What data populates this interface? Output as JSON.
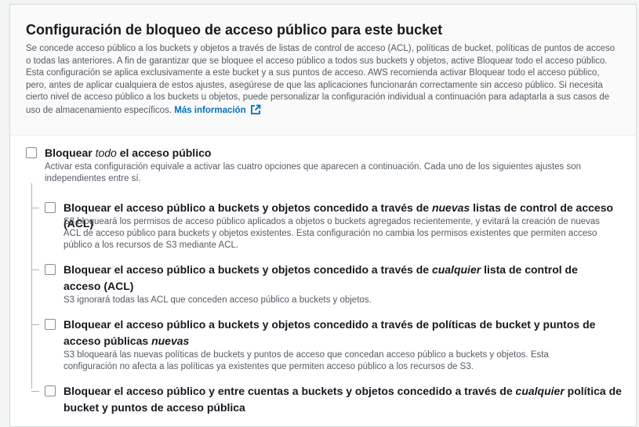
{
  "header": {
    "title": "Configuración de bloqueo de acceso público para este bucket",
    "description": "Se concede acceso público a los buckets y objetos a través de listas de control de acceso (ACL), políticas de bucket, políticas de puntos de acceso o todas las anteriores. A fin de garantizar que se bloquee el acceso público a todos sus buckets y objetos, active Bloquear todo el acceso público. Esta configuración se aplica exclusivamente a este bucket y a sus puntos de acceso. AWS recomienda activar Bloquear todo el acceso público, pero, antes de aplicar cualquiera de estos ajustes, asegúrese de que las aplicaciones funcionarán correctamente sin acceso público. Si necesita cierto nivel de acceso público a los buckets u objetos, puede personalizar la configuración individual a continuación para adaptarla a sus casos de uso de almacenamiento específicos.",
    "learn_more": "Más información",
    "learn_more_icon": "external-link-icon"
  },
  "block_all": {
    "label_pre": "Bloquear ",
    "label_em": "todo",
    "label_post": " el acceso público",
    "description": "Activar esta configuración equivale a activar las cuatro opciones que aparecen a continuación. Cada uno de los siguientes ajustes son independientes entre sí.",
    "checked": false
  },
  "options": [
    {
      "label_pre": "Bloquear el acceso público a buckets y objetos concedido a través de ",
      "label_em": "nuevas",
      "label_post": " listas de control de acceso (ACL)",
      "description": "S3 bloqueará los permisos de acceso público aplicados a objetos o buckets agregados recientemente, y evitará la creación de nuevas ACL de acceso público para buckets y objetos existentes. Esta configuración no cambia los permisos existentes que permiten acceso público a los recursos de S3 mediante ACL.",
      "checked": false
    },
    {
      "label_pre": "Bloquear el acceso público a buckets y objetos concedido a través de ",
      "label_em": "cualquier",
      "label_post": " lista de control de acceso (ACL)",
      "description": "S3 ignorará todas las ACL que conceden acceso público a buckets y objetos.",
      "checked": false
    },
    {
      "label_pre": "Bloquear el acceso público a buckets y objetos concedido a través de políticas de bucket y puntos de acceso públicas ",
      "label_em": "nuevas",
      "label_post": "",
      "description": "S3 bloqueará las nuevas políticas de buckets y puntos de acceso que concedan acceso público a buckets y objetos. Esta configuración no afecta a las políticas ya existentes que permiten acceso público a los recursos de S3.",
      "checked": false
    },
    {
      "label_pre": "Bloquear el acceso público y entre cuentas a buckets y objetos concedido a través de ",
      "label_em": "cualquier",
      "label_post": " política de bucket y puntos de acceso pública",
      "description": "",
      "checked": false
    }
  ]
}
